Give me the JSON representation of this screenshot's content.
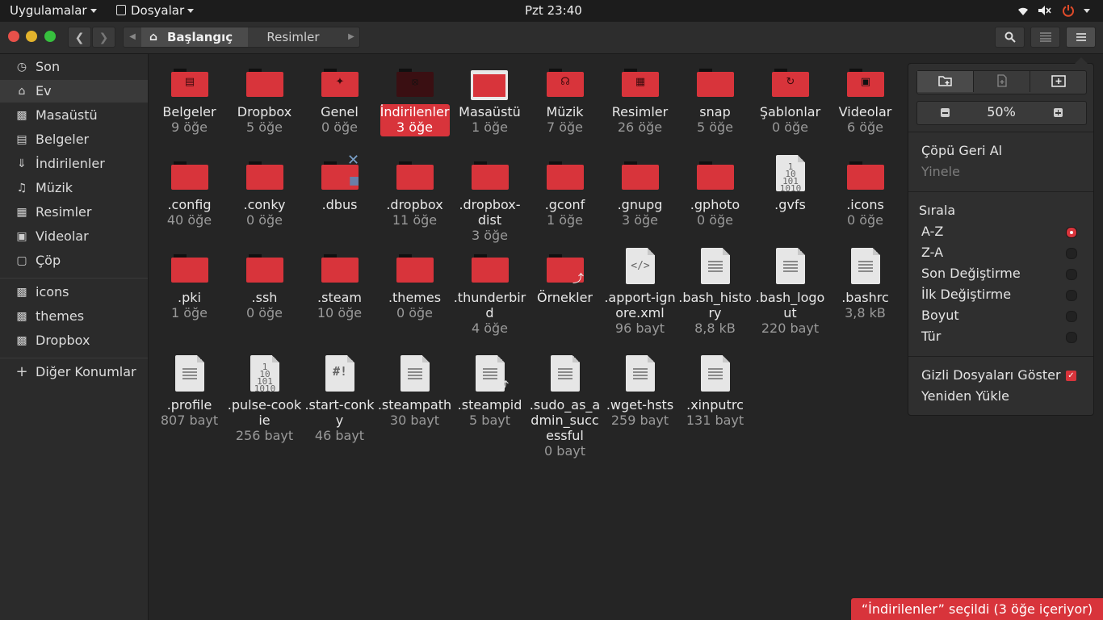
{
  "topbar": {
    "apps_label": "Uygulamalar",
    "files_label": "Dosyalar",
    "clock": "Pzt 23:40"
  },
  "header": {
    "path": [
      "Başlangıç",
      "Resimler"
    ]
  },
  "sidebar": {
    "items": [
      {
        "label": "Son",
        "icon": "clock-icon"
      },
      {
        "label": "Ev",
        "icon": "home-icon"
      },
      {
        "label": "Masaüstü",
        "icon": "folder-icon"
      },
      {
        "label": "Belgeler",
        "icon": "document-icon"
      },
      {
        "label": "İndirilenler",
        "icon": "download-icon"
      },
      {
        "label": "Müzik",
        "icon": "music-icon"
      },
      {
        "label": "Resimler",
        "icon": "image-icon"
      },
      {
        "label": "Videolar",
        "icon": "film-icon"
      },
      {
        "label": "Çöp",
        "icon": "trash-icon"
      }
    ],
    "bookmarks": [
      {
        "label": "icons",
        "icon": "folder-icon"
      },
      {
        "label": "themes",
        "icon": "folder-icon"
      },
      {
        "label": "Dropbox",
        "icon": "folder-icon"
      }
    ],
    "other": "Diğer Konumlar"
  },
  "files": [
    {
      "name": "Belgeler",
      "meta": "9 öğe"
    },
    {
      "name": "Dropbox",
      "meta": "5 öğe"
    },
    {
      "name": "Genel",
      "meta": "0 öğe"
    },
    {
      "name": "İndirilenler",
      "meta": "3 öğe"
    },
    {
      "name": "Masaüstü",
      "meta": "1 öğe"
    },
    {
      "name": "Müzik",
      "meta": "7 öğe"
    },
    {
      "name": "Resimler",
      "meta": "26 öğe"
    },
    {
      "name": "snap",
      "meta": "5 öğe"
    },
    {
      "name": "Şablonlar",
      "meta": "0 öğe"
    },
    {
      "name": "Videolar",
      "meta": "6 öğe"
    },
    {
      "name": ".config",
      "meta": "40 öğe"
    },
    {
      "name": ".conky",
      "meta": "0 öğe"
    },
    {
      "name": ".dbus",
      "meta": ""
    },
    {
      "name": ".dropbox",
      "meta": "11 öğe"
    },
    {
      "name": ".dropbox-dist",
      "meta": "3 öğe"
    },
    {
      "name": ".gconf",
      "meta": "1 öğe"
    },
    {
      "name": ".gnupg",
      "meta": "3 öğe"
    },
    {
      "name": ".gphoto",
      "meta": "0 öğe"
    },
    {
      "name": ".gvfs",
      "meta": ""
    },
    {
      "name": ".icons",
      "meta": "0 öğe"
    },
    {
      "name": ".pki",
      "meta": "1 öğe"
    },
    {
      "name": ".ssh",
      "meta": "0 öğe"
    },
    {
      "name": ".steam",
      "meta": "10 öğe"
    },
    {
      "name": ".themes",
      "meta": "0 öğe"
    },
    {
      "name": ".thunderbird",
      "meta": "4 öğe"
    },
    {
      "name": "Örnekler",
      "meta": ""
    },
    {
      "name": ".apport-ignore.xml",
      "meta": "96 bayt"
    },
    {
      "name": ".bash_history",
      "meta": "8,8 kB"
    },
    {
      "name": ".bash_logout",
      "meta": "220 bayt"
    },
    {
      "name": ".bashrc",
      "meta": "3,8 kB"
    },
    {
      "name": ".profile",
      "meta": "807 bayt"
    },
    {
      "name": ".pulse-cookie",
      "meta": "256 bayt"
    },
    {
      "name": ".start-conky",
      "meta": "46 bayt"
    },
    {
      "name": ".steampath",
      "meta": "30 bayt"
    },
    {
      "name": ".steampid",
      "meta": "5 bayt"
    },
    {
      "name": ".sudo_as_admin_successful",
      "meta": "0 bayt"
    },
    {
      "name": ".wget-hsts",
      "meta": "259 bayt"
    },
    {
      "name": ".xinputrc",
      "meta": "131 bayt"
    }
  ],
  "popover": {
    "zoom": "50%",
    "undo_trash": "Çöpü Geri Al",
    "redo": "Yinele",
    "sort_title": "Sırala",
    "sort_options": [
      "A-Z",
      "Z-A",
      "Son Değiştirme",
      "İlk Değiştirme",
      "Boyut",
      "Tür"
    ],
    "show_hidden": "Gizli Dosyaları Göster",
    "reload": "Yeniden Yükle"
  },
  "status": "“İndirilenler” seçildi (3 öğe içeriyor)",
  "colors": {
    "accent": "#d8343b"
  }
}
